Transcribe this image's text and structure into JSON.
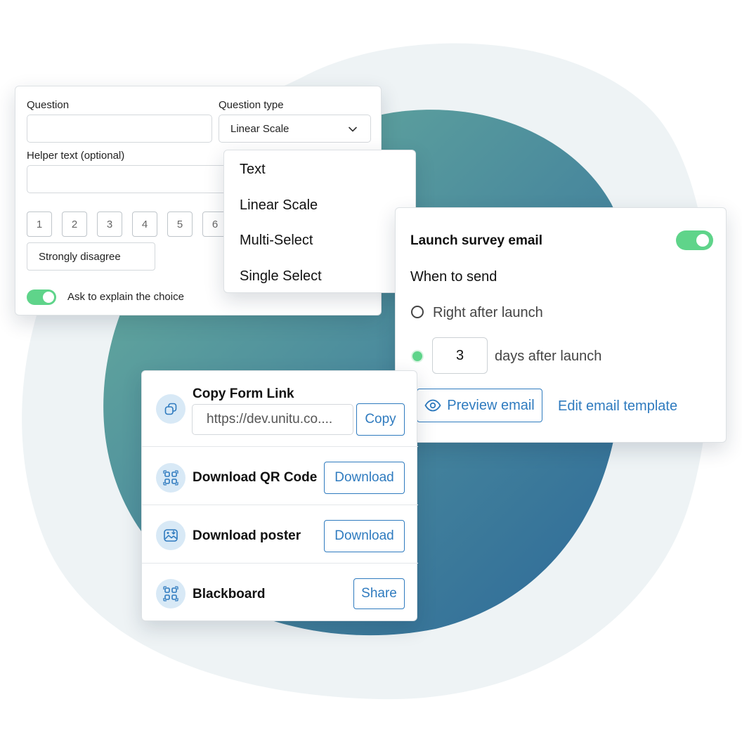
{
  "question_card": {
    "question_label": "Question",
    "question_value": "",
    "question_type_label": "Question type",
    "question_type_value": "Linear Scale",
    "helper_label": "Helper text (optional)",
    "helper_value": "",
    "scale": [
      "1",
      "2",
      "3",
      "4",
      "5",
      "6"
    ],
    "min_label": "Strongly disagree",
    "explain_toggle_on": true,
    "explain_label": "Ask to explain the choice"
  },
  "type_menu": {
    "items": [
      "Text",
      "Linear Scale",
      "Multi-Select",
      "Single Select"
    ]
  },
  "email_card": {
    "title": "Launch survey email",
    "enabled": true,
    "when_label": "When to send",
    "option_right_after": "Right after launch",
    "days_value": "3",
    "days_suffix": "days after launch",
    "selected_option": "days",
    "preview_label": "Preview email",
    "edit_label": "Edit email template"
  },
  "share_card": {
    "copy_title": "Copy Form Link",
    "link_value": "https://dev.unitu.co....",
    "copy_button": "Copy",
    "qr_title": "Download QR Code",
    "qr_button": "Download",
    "poster_title": "Download poster",
    "poster_button": "Download",
    "blackboard_title": "Blackboard",
    "blackboard_button": "Share"
  },
  "colors": {
    "accent_blue": "#2f7bbf",
    "toggle_green": "#5fd48a",
    "icon_bg": "#d8e9f6",
    "blob_teal": "#6cb39d",
    "blob_blue": "#2c6898",
    "blob_outer": "#eef3f5"
  }
}
